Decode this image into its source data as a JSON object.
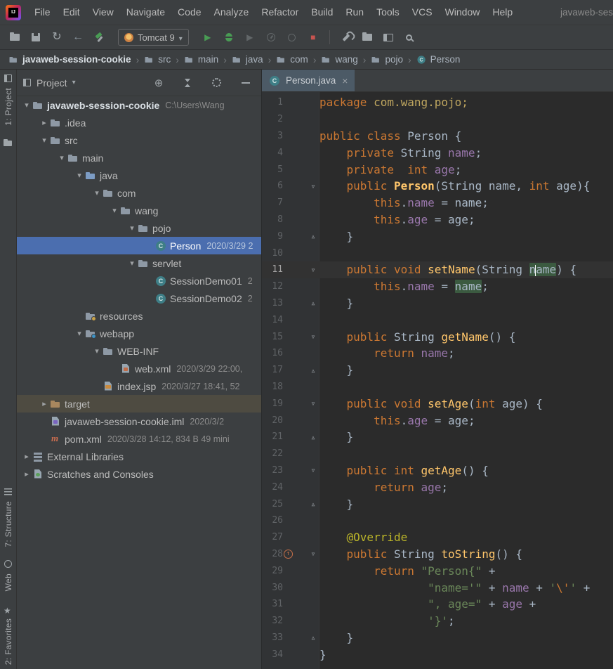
{
  "window": {
    "title": "javaweb-ses"
  },
  "colors": {
    "panel_bg": "#3C3F41",
    "editor_bg": "#2B2B2B",
    "txt": "#A9B7C6",
    "kw": "#CC7832",
    "fld": "#9876AA",
    "mth": "#FFC66B",
    "str": "#6A8759",
    "ann": "#BBB529",
    "esc": "#CC7832",
    "pkg": "#BFA65F",
    "selection": "#4B6EAF",
    "hover": "#4E4B41",
    "id_highlight": "#3B5A40",
    "green": "#499C54",
    "red": "#C75450"
  },
  "menu_bar": {
    "items": [
      "File",
      "Edit",
      "View",
      "Navigate",
      "Code",
      "Analyze",
      "Refactor",
      "Build",
      "Run",
      "Tools",
      "VCS",
      "Window",
      "Help"
    ]
  },
  "toolbar": {
    "run_config": "Tomcat 9",
    "left_buttons": [
      {
        "name": "open",
        "icon": "folder-open",
        "enabled": true
      },
      {
        "name": "save-all",
        "icon": "floppy",
        "enabled": true
      },
      {
        "name": "synchronize",
        "icon": "refresh",
        "enabled": true
      },
      {
        "name": "back",
        "icon": "arrow-left",
        "enabled": true
      },
      {
        "name": "build",
        "icon": "hammer",
        "enabled": true
      }
    ],
    "run_buttons": [
      {
        "name": "run",
        "icon": "play",
        "enabled": true
      },
      {
        "name": "debug",
        "icon": "bug",
        "enabled": true
      },
      {
        "name": "run-with-coverage",
        "icon": "play-shield",
        "enabled": false
      },
      {
        "name": "profiler",
        "icon": "profiler",
        "enabled": false
      },
      {
        "name": "attach",
        "icon": "circle",
        "enabled": false
      },
      {
        "name": "stop",
        "icon": "stop",
        "enabled": true
      }
    ],
    "right_buttons": [
      {
        "name": "settings-wrench",
        "icon": "wrench",
        "enabled": true
      },
      {
        "name": "project-structure",
        "icon": "folder-open",
        "enabled": true
      },
      {
        "name": "tool-windows",
        "icon": "window",
        "enabled": true
      },
      {
        "name": "search-everywhere",
        "icon": "magnifier",
        "enabled": true
      }
    ]
  },
  "nav_bar": {
    "items": [
      {
        "label": "javaweb-session-cookie",
        "icon": "folder",
        "bold": true
      },
      {
        "label": "src",
        "icon": "folder"
      },
      {
        "label": "main",
        "icon": "folder"
      },
      {
        "label": "java",
        "icon": "folder"
      },
      {
        "label": "com",
        "icon": "folder"
      },
      {
        "label": "wang",
        "icon": "folder"
      },
      {
        "label": "pojo",
        "icon": "folder"
      },
      {
        "label": "Person",
        "icon": "class"
      }
    ]
  },
  "tool_strip": {
    "top": [
      {
        "label": "1: Project",
        "icon": "project"
      },
      {
        "label": "",
        "icon": "folder"
      }
    ],
    "bottom": [
      {
        "label": "7: Structure",
        "icon": "structure"
      },
      {
        "label": "Web",
        "icon": "web"
      },
      {
        "label": "2: Favorites",
        "icon": "favorites"
      }
    ]
  },
  "project_panel": {
    "title": "Project",
    "actions": [
      "locate",
      "collapse-all",
      "settings",
      "hide"
    ]
  },
  "tree": {
    "rows": [
      {
        "label": "javaweb-session-cookie",
        "meta": "C:\\Users\\Wang",
        "depth": 0,
        "icon": "folder-project",
        "arrow": "down",
        "bold": true
      },
      {
        "label": ".idea",
        "depth": 1,
        "icon": "folder",
        "arrow": "right"
      },
      {
        "label": "src",
        "depth": 1,
        "icon": "folder",
        "arrow": "down"
      },
      {
        "label": "main",
        "depth": 2,
        "icon": "folder",
        "arrow": "down"
      },
      {
        "label": "java",
        "depth": 3,
        "icon": "folder-src",
        "arrow": "down"
      },
      {
        "label": "com",
        "depth": 4,
        "icon": "package",
        "arrow": "down"
      },
      {
        "label": "wang",
        "depth": 5,
        "icon": "package",
        "arrow": "down"
      },
      {
        "label": "pojo",
        "depth": 6,
        "icon": "package",
        "arrow": "down"
      },
      {
        "label": "Person",
        "meta": "2020/3/29 2",
        "depth": 7,
        "icon": "class",
        "state": "selected"
      },
      {
        "label": "servlet",
        "depth": 6,
        "icon": "package",
        "arrow": "down"
      },
      {
        "label": "SessionDemo01",
        "meta": "2",
        "depth": 7,
        "icon": "class"
      },
      {
        "label": "SessionDemo02",
        "meta": "2",
        "depth": 7,
        "icon": "class"
      },
      {
        "label": "resources",
        "depth": 3,
        "icon": "folder-res"
      },
      {
        "label": "webapp",
        "depth": 3,
        "icon": "folder-web",
        "arrow": "down"
      },
      {
        "label": "WEB-INF",
        "depth": 4,
        "icon": "folder",
        "arrow": "down"
      },
      {
        "label": "web.xml",
        "meta": "2020/3/29 22:00,",
        "depth": 5,
        "icon": "file-xml"
      },
      {
        "label": "index.jsp",
        "meta": "2020/3/27 18:41, 52",
        "depth": 4,
        "icon": "file-jsp"
      },
      {
        "label": "target",
        "depth": 1,
        "icon": "folder-excluded",
        "arrow": "right",
        "state": "hover"
      },
      {
        "label": "javaweb-session-cookie.iml",
        "meta": "2020/3/2",
        "depth": 1,
        "icon": "file-iml"
      },
      {
        "label": "pom.xml",
        "meta": "2020/3/28 14:12, 834 B 49 mini",
        "depth": 1,
        "icon": "maven"
      },
      {
        "label": "External Libraries",
        "depth": 0,
        "icon": "lib",
        "arrow": "right"
      },
      {
        "label": "Scratches and Consoles",
        "depth": 0,
        "icon": "scratch",
        "arrow": "right"
      }
    ]
  },
  "editor": {
    "tab": "Person.java",
    "lines": [
      {
        "n": 1,
        "segs": [
          [
            "kw",
            "package"
          ],
          [
            "pl",
            " "
          ],
          [
            "pkg",
            "com.wang.pojo;"
          ]
        ]
      },
      {
        "n": 2,
        "segs": []
      },
      {
        "n": 3,
        "segs": [
          [
            "kw",
            "public"
          ],
          [
            "pl",
            " "
          ],
          [
            "kw",
            "class"
          ],
          [
            "pl",
            " Person {"
          ]
        ]
      },
      {
        "n": 4,
        "segs": [
          [
            "pl",
            "    "
          ],
          [
            "kw",
            "private"
          ],
          [
            "pl",
            " String "
          ],
          [
            "fld",
            "name"
          ],
          [
            "pl",
            ";"
          ]
        ]
      },
      {
        "n": 5,
        "segs": [
          [
            "pl",
            "    "
          ],
          [
            "kw",
            "private"
          ],
          [
            "pl",
            "  "
          ],
          [
            "kw",
            "int"
          ],
          [
            "pl",
            " "
          ],
          [
            "fld",
            "age"
          ],
          [
            "pl",
            ";"
          ]
        ]
      },
      {
        "n": 6,
        "fold": "down",
        "segs": [
          [
            "pl",
            "    "
          ],
          [
            "kw",
            "public"
          ],
          [
            "pl",
            " "
          ],
          [
            "ctor",
            "Person"
          ],
          [
            "pl",
            "(String name, "
          ],
          [
            "kw",
            "int"
          ],
          [
            "pl",
            " age){"
          ]
        ]
      },
      {
        "n": 7,
        "segs": [
          [
            "pl",
            "        "
          ],
          [
            "kw",
            "this"
          ],
          [
            "pl",
            "."
          ],
          [
            "fld",
            "name"
          ],
          [
            "pl",
            " = name;"
          ]
        ]
      },
      {
        "n": 8,
        "segs": [
          [
            "pl",
            "        "
          ],
          [
            "kw",
            "this"
          ],
          [
            "pl",
            "."
          ],
          [
            "fld",
            "age"
          ],
          [
            "pl",
            " = age;"
          ]
        ]
      },
      {
        "n": 9,
        "fold": "up",
        "segs": [
          [
            "pl",
            "    }"
          ]
        ]
      },
      {
        "n": 10,
        "segs": []
      },
      {
        "n": 11,
        "fold": "down",
        "current": true,
        "segs": [
          [
            "pl",
            "    "
          ],
          [
            "kw",
            "public"
          ],
          [
            "pl",
            " "
          ],
          [
            "kw",
            "void"
          ],
          [
            "pl",
            " "
          ],
          [
            "mth",
            "setName"
          ],
          [
            "pl",
            "(String "
          ],
          [
            "hl",
            "n"
          ],
          [
            "caret",
            ""
          ],
          [
            "hl",
            "ame"
          ],
          [
            "pl",
            ") {"
          ]
        ]
      },
      {
        "n": 12,
        "segs": [
          [
            "pl",
            "        "
          ],
          [
            "kw",
            "this"
          ],
          [
            "pl",
            "."
          ],
          [
            "fld",
            "name"
          ],
          [
            "pl",
            " = "
          ],
          [
            "hl",
            "name"
          ],
          [
            "pl",
            ";"
          ]
        ]
      },
      {
        "n": 13,
        "fold": "up",
        "segs": [
          [
            "pl",
            "    }"
          ]
        ]
      },
      {
        "n": 14,
        "segs": []
      },
      {
        "n": 15,
        "fold": "down",
        "segs": [
          [
            "pl",
            "    "
          ],
          [
            "kw",
            "public"
          ],
          [
            "pl",
            " String "
          ],
          [
            "mth",
            "getName"
          ],
          [
            "pl",
            "() {"
          ]
        ]
      },
      {
        "n": 16,
        "segs": [
          [
            "pl",
            "        "
          ],
          [
            "kw",
            "return"
          ],
          [
            "pl",
            " "
          ],
          [
            "fld",
            "name"
          ],
          [
            "pl",
            ";"
          ]
        ]
      },
      {
        "n": 17,
        "fold": "up",
        "segs": [
          [
            "pl",
            "    }"
          ]
        ]
      },
      {
        "n": 18,
        "segs": []
      },
      {
        "n": 19,
        "fold": "down",
        "segs": [
          [
            "pl",
            "    "
          ],
          [
            "kw",
            "public"
          ],
          [
            "pl",
            " "
          ],
          [
            "kw",
            "void"
          ],
          [
            "pl",
            " "
          ],
          [
            "mth",
            "setAge"
          ],
          [
            "pl",
            "("
          ],
          [
            "kw",
            "int"
          ],
          [
            "pl",
            " age) {"
          ]
        ]
      },
      {
        "n": 20,
        "segs": [
          [
            "pl",
            "        "
          ],
          [
            "kw",
            "this"
          ],
          [
            "pl",
            "."
          ],
          [
            "fld",
            "age"
          ],
          [
            "pl",
            " = age;"
          ]
        ]
      },
      {
        "n": 21,
        "fold": "up",
        "segs": [
          [
            "pl",
            "    }"
          ]
        ]
      },
      {
        "n": 22,
        "segs": []
      },
      {
        "n": 23,
        "fold": "down",
        "segs": [
          [
            "pl",
            "    "
          ],
          [
            "kw",
            "public"
          ],
          [
            "pl",
            " "
          ],
          [
            "kw",
            "int"
          ],
          [
            "pl",
            " "
          ],
          [
            "mth",
            "getAge"
          ],
          [
            "pl",
            "() {"
          ]
        ]
      },
      {
        "n": 24,
        "segs": [
          [
            "pl",
            "        "
          ],
          [
            "kw",
            "return"
          ],
          [
            "pl",
            " "
          ],
          [
            "fld",
            "age"
          ],
          [
            "pl",
            ";"
          ]
        ]
      },
      {
        "n": 25,
        "fold": "up",
        "segs": [
          [
            "pl",
            "    }"
          ]
        ]
      },
      {
        "n": 26,
        "segs": []
      },
      {
        "n": 27,
        "segs": [
          [
            "pl",
            "    "
          ],
          [
            "ann",
            "@Override"
          ]
        ]
      },
      {
        "n": 28,
        "fold": "down",
        "override": true,
        "segs": [
          [
            "pl",
            "    "
          ],
          [
            "kw",
            "public"
          ],
          [
            "pl",
            " String "
          ],
          [
            "mth",
            "toString"
          ],
          [
            "pl",
            "() {"
          ]
        ]
      },
      {
        "n": 29,
        "segs": [
          [
            "pl",
            "        "
          ],
          [
            "kw",
            "return"
          ],
          [
            "pl",
            " "
          ],
          [
            "str",
            "\"Person{\""
          ],
          [
            "pl",
            " +"
          ]
        ]
      },
      {
        "n": 30,
        "segs": [
          [
            "pl",
            "                "
          ],
          [
            "str",
            "\"name='\""
          ],
          [
            "pl",
            " + "
          ],
          [
            "fld",
            "name"
          ],
          [
            "pl",
            " + "
          ],
          [
            "str",
            "'"
          ],
          [
            "esc",
            "\\'"
          ],
          [
            "str",
            "'"
          ],
          [
            "pl",
            " +"
          ]
        ]
      },
      {
        "n": 31,
        "segs": [
          [
            "pl",
            "                "
          ],
          [
            "str",
            "\", age=\""
          ],
          [
            "pl",
            " + "
          ],
          [
            "fld",
            "age"
          ],
          [
            "pl",
            " +"
          ]
        ]
      },
      {
        "n": 32,
        "segs": [
          [
            "pl",
            "                "
          ],
          [
            "str",
            "'}'"
          ],
          [
            "pl",
            ";"
          ]
        ]
      },
      {
        "n": 33,
        "fold": "up",
        "segs": [
          [
            "pl",
            "    }"
          ]
        ]
      },
      {
        "n": 34,
        "segs": [
          [
            "pl",
            "}"
          ]
        ]
      }
    ]
  }
}
